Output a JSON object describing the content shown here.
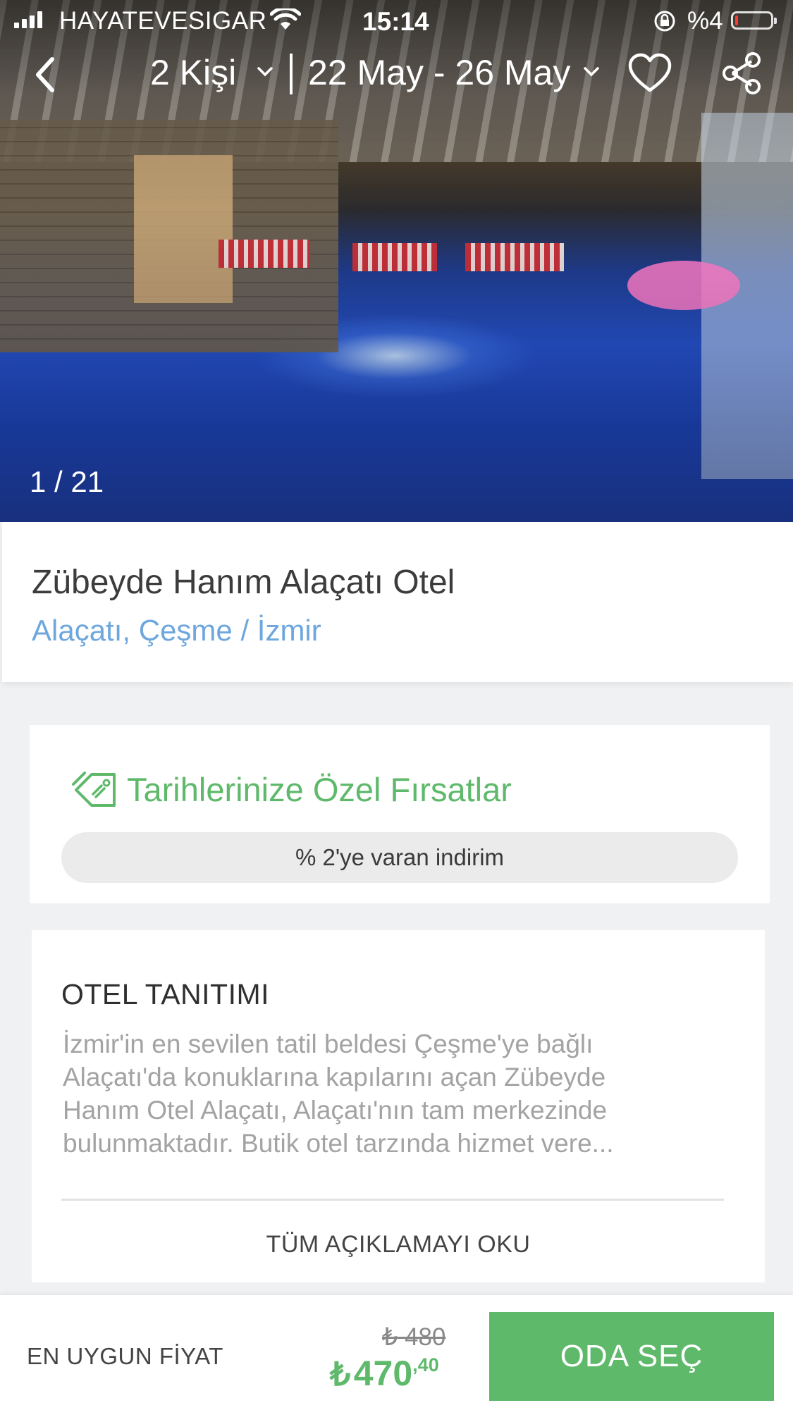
{
  "status_bar": {
    "carrier": "HAYATEVESIGAR",
    "time": "15:14",
    "battery_text": "%4"
  },
  "header": {
    "guests": "2 Kişi",
    "dates": "22 May - 26 May"
  },
  "gallery": {
    "counter": "1 / 21"
  },
  "hotel": {
    "name": "Zübeyde Hanım Alaçatı Otel",
    "location": "Alaçatı, Çeşme / İzmir"
  },
  "deals": {
    "title": "Tarihlerinize Özel Fırsatlar",
    "discount": "% 2'ye varan indirim"
  },
  "description": {
    "heading": "OTEL TANITIMI",
    "lines": [
      "İzmir'in en sevilen tatil beldesi Çeşme'ye bağlı",
      "Alaçatı'da konuklarına kapılarını açan Zübeyde",
      "Hanım Otel Alaçatı, Alaçatı'nın tam merkezinde",
      "bulunmaktadır. Butik otel tarzında hizmet vere..."
    ],
    "read_more": "TÜM AÇIKLAMAYI OKU"
  },
  "footer": {
    "label": "EN UYGUN FİYAT",
    "old_price": "₺ 480",
    "currency": "₺",
    "price_main": "470",
    "price_cents": ",40",
    "cta": "ODA SEÇ"
  },
  "colors": {
    "accent_green": "#5fb96b",
    "link_blue": "#6ea7dd"
  }
}
